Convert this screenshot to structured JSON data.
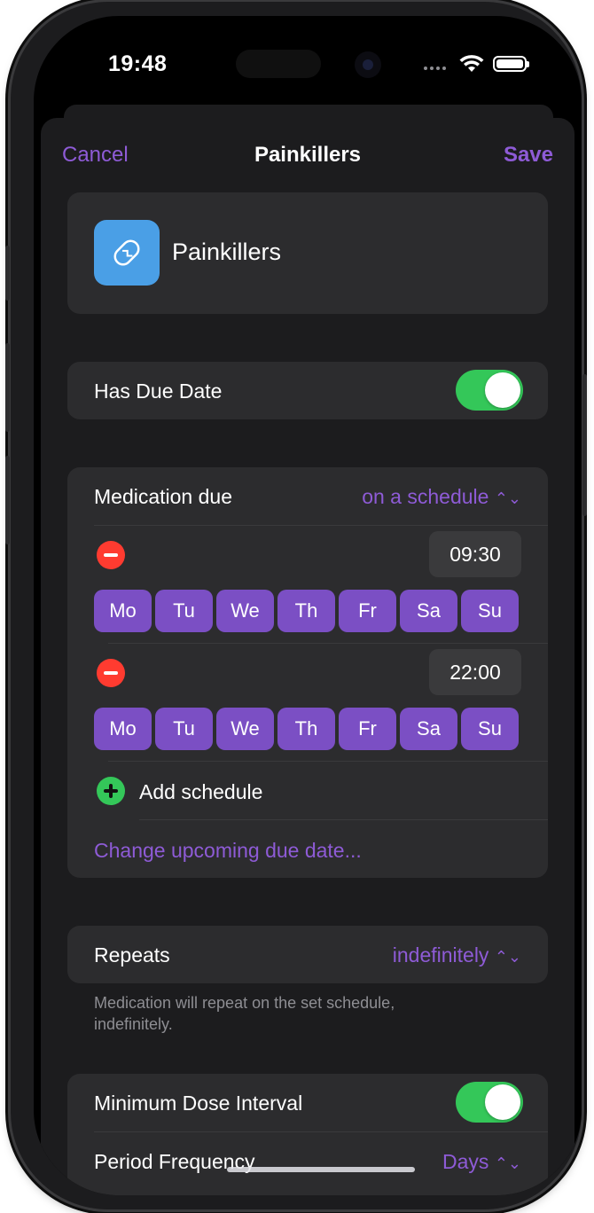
{
  "status": {
    "time": "19:48"
  },
  "nav": {
    "cancel": "Cancel",
    "title": "Painkillers",
    "save": "Save"
  },
  "medication": {
    "icon": "pill-icon",
    "name": "Painkillers"
  },
  "due_date": {
    "label": "Has Due Date",
    "enabled": true
  },
  "schedule": {
    "label": "Medication due",
    "value": "on a schedule",
    "entries": [
      {
        "time": "09:30",
        "days": [
          "Mo",
          "Tu",
          "We",
          "Th",
          "Fr",
          "Sa",
          "Su"
        ]
      },
      {
        "time": "22:00",
        "days": [
          "Mo",
          "Tu",
          "We",
          "Th",
          "Fr",
          "Sa",
          "Su"
        ]
      }
    ],
    "add_label": "Add schedule",
    "change_link": "Change upcoming due date..."
  },
  "repeats": {
    "label": "Repeats",
    "value": "indefinitely",
    "footnote": "Medication will repeat on the set schedule, indefinitely."
  },
  "min_dose": {
    "label": "Minimum Dose Interval",
    "enabled": true
  },
  "period": {
    "label": "Period Frequency",
    "value": "Days"
  },
  "colors": {
    "accent": "#8e5bd6",
    "day_chip": "#7b4fc4",
    "toggle_on": "#34c759",
    "remove": "#ff3b30",
    "icon_bg": "#4a9fe6"
  }
}
